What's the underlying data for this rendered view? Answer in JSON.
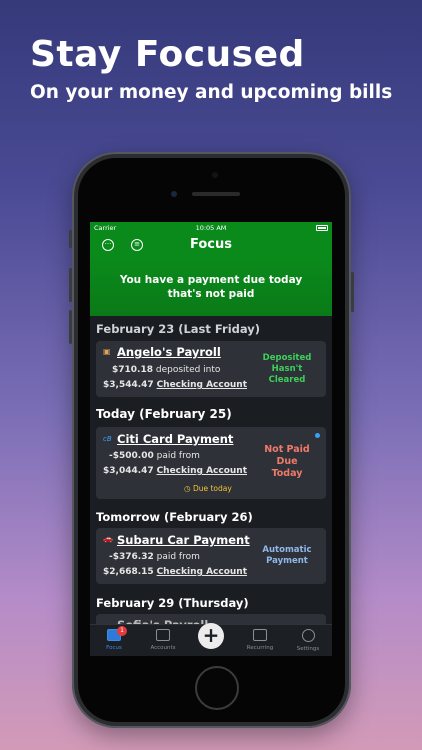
{
  "marketing": {
    "headline": "Stay Focused",
    "subhead": "On your money and upcoming bills"
  },
  "status_bar": {
    "carrier": "Carrier",
    "time": "10:05 AM"
  },
  "nav": {
    "title": "Focus",
    "left_icon": "more-icon",
    "filter_icon": "filter-icon"
  },
  "banner": {
    "line1": "You have a payment due today",
    "line2": "that's not paid"
  },
  "sections": {
    "last_friday": {
      "header": "February 23 (Last Friday)",
      "card": {
        "icon": "payroll-icon",
        "title": "Angelo's Payroll",
        "amount": "$710.18",
        "action": "deposited into",
        "balance": "$3,544.47",
        "account": "Checking Account",
        "status": [
          "Deposited",
          "Hasn't",
          "Cleared"
        ],
        "status_color": "#3ecf5a"
      }
    },
    "today": {
      "header": "Today (February 25)",
      "card": {
        "icon": "citi-icon",
        "icon_text": "citi",
        "title": "Citi Card Payment",
        "amount": "-$500.00",
        "action": "paid from",
        "balance": "$3,044.47",
        "account": "Checking Account",
        "status": [
          "Not Paid",
          "Due",
          "Today"
        ],
        "status_color": "#f07a6a",
        "due_label": "Due today",
        "due_icon": "timer-icon"
      }
    },
    "tomorrow": {
      "header": "Tomorrow (February 26)",
      "card": {
        "icon": "car-icon",
        "title": "Subaru Car Payment",
        "amount": "-$376.32",
        "action": "paid from",
        "balance": "$2,668.15",
        "account": "Checking Account",
        "status": [
          "Automatic",
          "Payment"
        ],
        "status_color": "#8fb7ec"
      }
    },
    "thursday": {
      "header": "February 29 (Thursday)",
      "card_title_partial": "Sofia's Payroll"
    }
  },
  "tabs": [
    {
      "label": "Focus",
      "icon": "focus-icon",
      "badge": "1",
      "active": true
    },
    {
      "label": "Accounts",
      "icon": "accounts-icon"
    },
    {
      "label": "",
      "icon": "add-icon"
    },
    {
      "label": "Recurring",
      "icon": "calendar-icon"
    },
    {
      "label": "Settings",
      "icon": "gear-icon"
    }
  ],
  "colors": {
    "nav_green": "#0b8a1c",
    "screen_bg": "#1a1d21",
    "card_bg": "#2e3238",
    "active_tab": "#3d8be8"
  }
}
